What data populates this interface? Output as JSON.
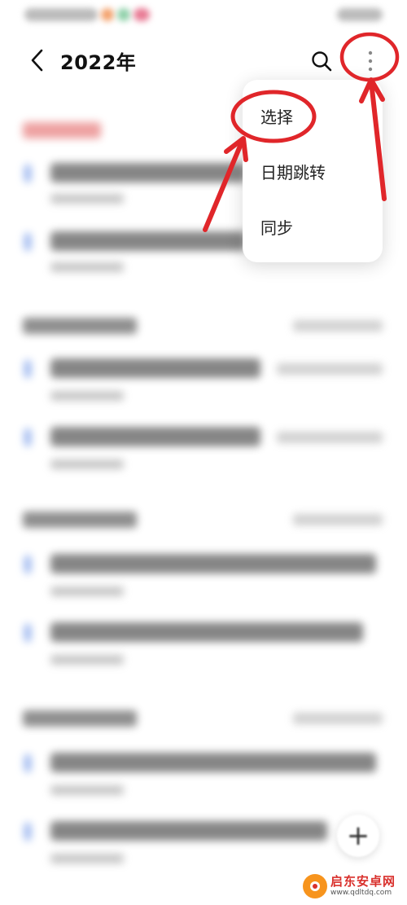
{
  "header": {
    "title": "2022年",
    "back_icon": "chevron-left-icon",
    "search_icon": "search-icon",
    "more_icon": "more-vertical-icon"
  },
  "menu": {
    "items": [
      {
        "label": "选择"
      },
      {
        "label": "日期跳转"
      },
      {
        "label": "同步"
      }
    ]
  },
  "fab": {
    "label": "+"
  },
  "watermark": {
    "name": "启东安卓网",
    "url": "www.qdltdq.com"
  },
  "colors": {
    "annotation_red": "#e0262a",
    "accent_blue": "#3b6fe0",
    "watermark_orange": "#f7941d"
  }
}
